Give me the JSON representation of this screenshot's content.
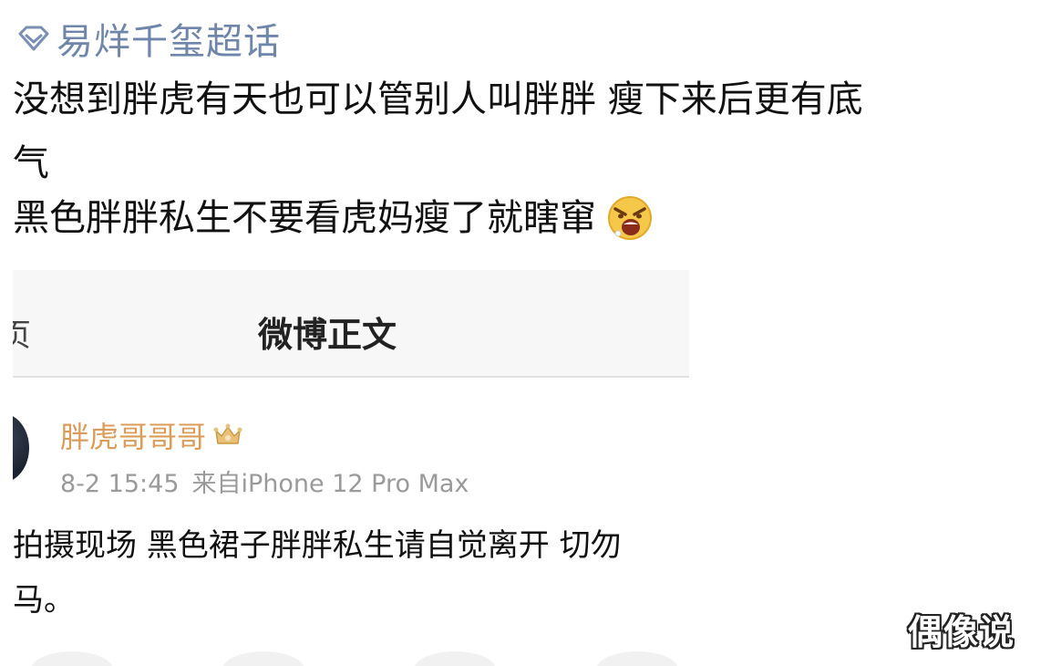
{
  "topic": {
    "icon": "diamond-icon",
    "name": "易烊千玺超话",
    "color": "#6f86aa"
  },
  "post": {
    "line1": "没想到胖虎有天也可以管别人叫胖胖 瘦下来后更有底",
    "line2": "气",
    "line3": "黑色胖胖私生不要看虎妈瘦了就瞎窜",
    "emoji": "angry-face-emoji"
  },
  "screenshot": {
    "nav_left_fragment": "页",
    "nav_title": "微博正文",
    "author": {
      "name": "胖虎哥哥哥",
      "name_color": "#d99c5a",
      "badge_icon": "crown-icon"
    },
    "meta": {
      "time": "8-2 15:45",
      "source": "来自iPhone 12 Pro Max"
    },
    "body_line1": "拍摄现场 黑色裙子胖胖私生请自觉离开 切勿",
    "body_line2": "马。"
  },
  "watermark": "偶像说"
}
